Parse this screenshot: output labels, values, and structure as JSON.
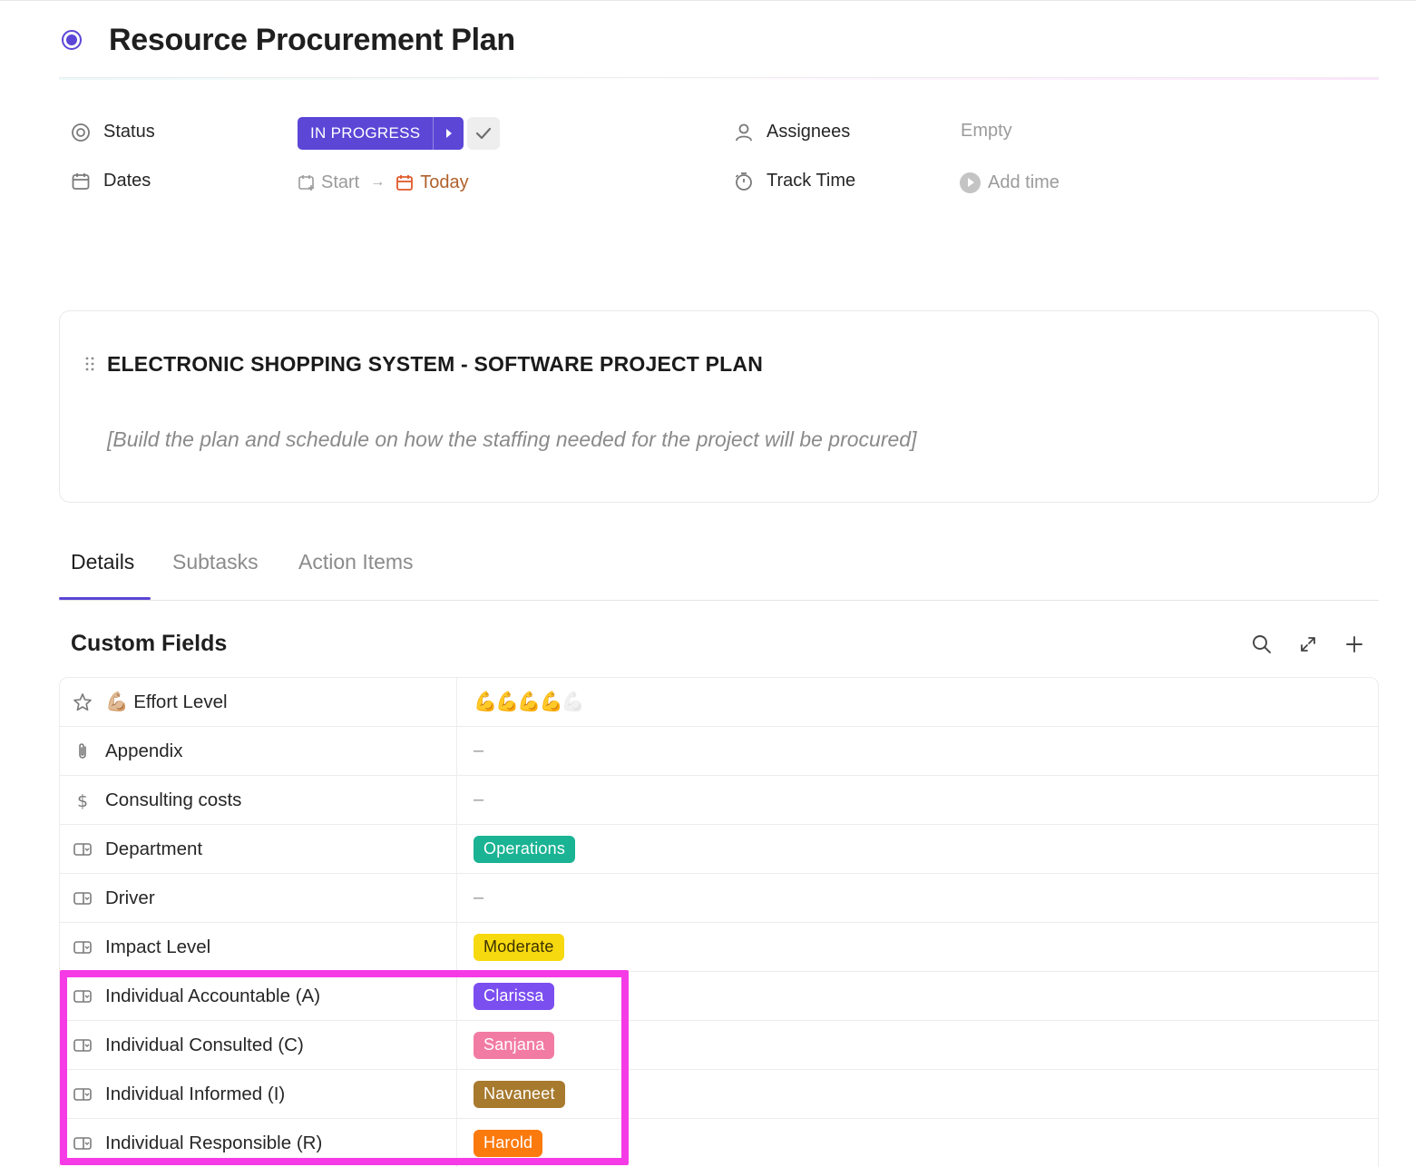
{
  "title": "Resource Procurement Plan",
  "properties": {
    "status_label": "Status",
    "status_value": "IN PROGRESS",
    "dates_label": "Dates",
    "start_placeholder": "Start",
    "due_value": "Today",
    "assignees_label": "Assignees",
    "assignees_value": "Empty",
    "track_time_label": "Track Time",
    "track_time_value": "Add time"
  },
  "description": {
    "heading": "ELECTRONIC SHOPPING SYSTEM - SOFTWARE PROJECT PLAN",
    "text": "[Build the plan and schedule on how the staffing needed for the project will be procured]"
  },
  "tabs": [
    {
      "label": "Details",
      "active": true
    },
    {
      "label": "Subtasks",
      "active": false
    },
    {
      "label": "Action Items",
      "active": false
    }
  ],
  "custom_fields": {
    "title": "Custom Fields",
    "tool_icons": [
      "search-icon",
      "expand-icon",
      "plus-icon"
    ],
    "rows": [
      {
        "name": "💪🏼 Effort Level",
        "icon": "star-icon",
        "type": "rating",
        "rating": 4,
        "max": 5
      },
      {
        "name": "Appendix",
        "icon": "paperclip-icon",
        "type": "text",
        "value": "–"
      },
      {
        "name": "Consulting costs",
        "icon": "dollar-icon",
        "type": "text",
        "value": "–"
      },
      {
        "name": "Department",
        "icon": "dropdown-icon",
        "type": "tag",
        "value": "Operations",
        "color": "#1ab394"
      },
      {
        "name": "Driver",
        "icon": "dropdown-icon",
        "type": "text",
        "value": "–"
      },
      {
        "name": "Impact Level",
        "icon": "dropdown-icon",
        "type": "tag",
        "value": "Moderate",
        "color": "#f7d90f",
        "text_color": "#3a3000"
      },
      {
        "name": "Individual Accountable (A)",
        "icon": "dropdown-icon",
        "type": "tag",
        "value": "Clarissa",
        "color": "#7b4ef0"
      },
      {
        "name": "Individual Consulted (C)",
        "icon": "dropdown-icon",
        "type": "tag",
        "value": "Sanjana",
        "color": "#f27ba4"
      },
      {
        "name": "Individual Informed (I)",
        "icon": "dropdown-icon",
        "type": "tag",
        "value": "Navaneet",
        "color": "#a77a2e"
      },
      {
        "name": "Individual Responsible (R)",
        "icon": "dropdown-icon",
        "type": "tag",
        "value": "Harold",
        "color": "#fb7a0e"
      }
    ]
  },
  "colors": {
    "accent": "#5b46d6",
    "highlight_border": "#f53ae6",
    "due_date": "#b0612a"
  }
}
